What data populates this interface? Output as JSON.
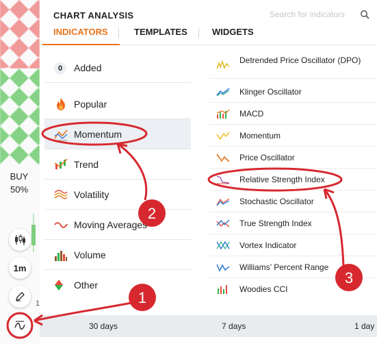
{
  "header": {
    "title": "CHART ANALYSIS",
    "search_placeholder": "Search for indicators",
    "tabs": [
      {
        "label": "INDICATORS",
        "active": true
      },
      {
        "label": "TEMPLATES",
        "active": false
      },
      {
        "label": "WIDGETS",
        "active": false
      }
    ]
  },
  "categories": [
    {
      "label": "Added",
      "badge": "0",
      "icon": "added-count-badge"
    },
    {
      "label": "Popular",
      "icon": "flame-icon"
    },
    {
      "label": "Momentum",
      "icon": "momentum-icon",
      "selected": true
    },
    {
      "label": "Trend",
      "icon": "trend-icon"
    },
    {
      "label": "Volatility",
      "icon": "volatility-icon"
    },
    {
      "label": "Moving Averages",
      "icon": "moving-averages-icon"
    },
    {
      "label": "Volume",
      "icon": "volume-icon"
    },
    {
      "label": "Other",
      "icon": "other-icon"
    }
  ],
  "indicators": [
    {
      "label": "Detrended Price Oscillator (DPO)",
      "icon": "dpo-icon"
    },
    {
      "label": "Klinger Oscillator",
      "icon": "klinger-icon"
    },
    {
      "label": "MACD",
      "icon": "macd-icon"
    },
    {
      "label": "Momentum",
      "icon": "momentum-line-icon"
    },
    {
      "label": "Price Oscillator",
      "icon": "price-oscillator-icon"
    },
    {
      "label": "Relative Strength Index",
      "icon": "rsi-icon",
      "highlighted": true
    },
    {
      "label": "Stochastic Oscillator",
      "icon": "stochastic-icon"
    },
    {
      "label": "True Strength Index",
      "icon": "tsi-icon"
    },
    {
      "label": "Vortex Indicator",
      "icon": "vortex-icon"
    },
    {
      "label": "Williams’ Percent Range",
      "icon": "williams-icon"
    },
    {
      "label": "Woodies CCI",
      "icon": "woodies-cci-icon"
    }
  ],
  "sidebar": {
    "buy_label": "BUY",
    "buy_percent": "50%",
    "timeframe": "1m",
    "axis_fragment": "1"
  },
  "range_bar": {
    "items": [
      "30 days",
      "7 days",
      "1 day"
    ]
  },
  "annotations": [
    {
      "number": "1"
    },
    {
      "number": "2"
    },
    {
      "number": "3"
    }
  ],
  "colors": {
    "accent": "#e8731a",
    "annotation_red": "#d7282f",
    "selected_bg": "#eceff3",
    "buy_green": "#7fd17f",
    "sell_red": "#f08c8c"
  }
}
